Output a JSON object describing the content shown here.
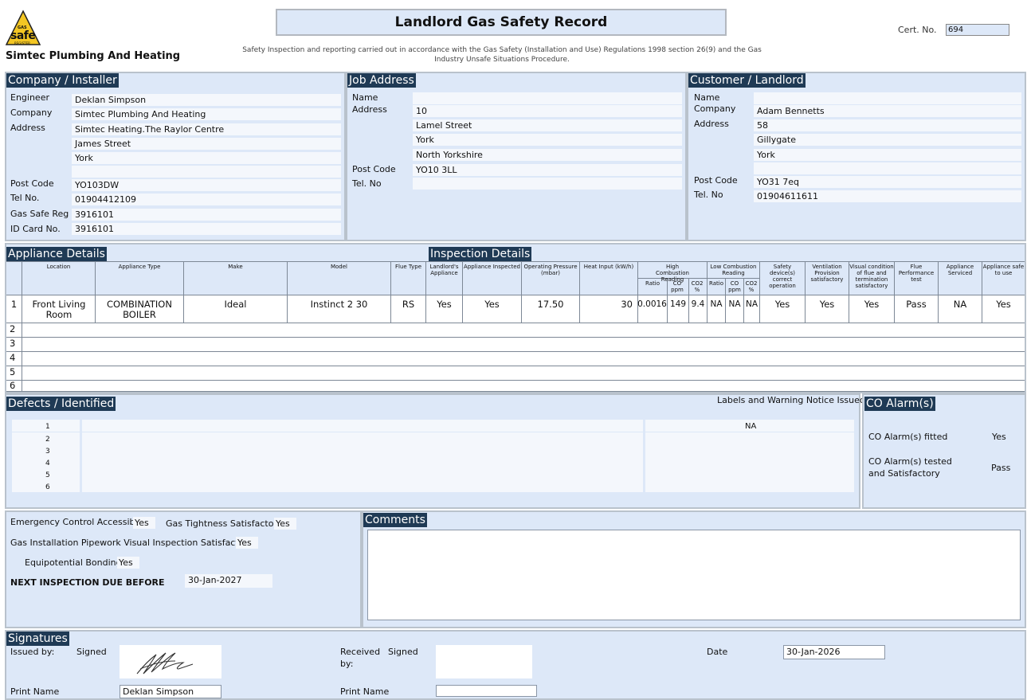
{
  "header": {
    "logo_text": "safe",
    "logo_small": "GAS",
    "logo_reg": "REGISTER",
    "company_name": "Simtec Plumbing And Heating",
    "title": "Landlord Gas Safety Record",
    "subtitle": "Safety Inspection and reporting carried out in accordance with the Gas Safety (Installation and Use) Regulations 1998 section 26(9) and the Gas Industry Unsafe Situations Procedure.",
    "cert_label": "Cert. No.",
    "cert_no": "694"
  },
  "installer": {
    "title": "Company / Installer",
    "labels": {
      "engineer": "Engineer",
      "company": "Company",
      "address": "Address",
      "post_code": "Post Code",
      "tel": "Tel No.",
      "gas_safe": "Gas Safe Reg",
      "id_card": "ID Card No."
    },
    "engineer": "Deklan Simpson",
    "company": "Simtec Plumbing And Heating",
    "address": [
      "Simtec Heating.The Raylor Centre",
      "James Street",
      "York",
      ""
    ],
    "post_code": "YO103DW",
    "tel": "01904412109",
    "gas_safe": "3916101",
    "id_card": "3916101"
  },
  "job": {
    "title": "Job Address",
    "labels": {
      "name": "Name",
      "address": "Address",
      "post_code": "Post Code",
      "tel": "Tel. No"
    },
    "name": "",
    "address": [
      "10",
      "Lamel Street",
      "York",
      "North Yorkshire"
    ],
    "post_code": "YO10 3LL",
    "tel": ""
  },
  "customer": {
    "title": "Customer / Landlord",
    "labels": {
      "name": "Name",
      "company": "Company",
      "address": "Address",
      "post_code": "Post Code",
      "tel": "Tel. No"
    },
    "name": "",
    "company": "Adam Bennetts",
    "address": [
      "58",
      "Gillygate",
      "York",
      ""
    ],
    "post_code": "YO31 7eq",
    "tel": "01904611611"
  },
  "appliances": {
    "title": "Appliance Details",
    "inspection_title": "Inspection Details",
    "headers": {
      "location": "Location",
      "type": "Appliance Type",
      "make": "Make",
      "model": "Model",
      "flue": "Flue Type",
      "landlords": "Landlord's Appliance",
      "inspected": "Appliance Inspected",
      "pressure": "Operating Pressure (mbar)",
      "heat": "Heat Input (kW/h)",
      "high": "High Combustion Reading",
      "low": "Low Combustion Reading",
      "ratio": "Ratio",
      "co": "CO ppm",
      "co2": "CO2 %",
      "safety": "Safety device(s) correct operation",
      "ventilation": "Ventilation Provision satisfactory",
      "visual": "Visual condition of flue and termination satisfactory",
      "flue_perf": "Flue Performance test",
      "serviced": "Appliance Serviced",
      "safe": "Appliance safe to use"
    },
    "row_numbers": [
      "1",
      "2",
      "3",
      "4",
      "5",
      "6"
    ],
    "row1": {
      "location": "Front Living Room",
      "type": "COMBINATION BOILER",
      "make": "Ideal",
      "model": "Instinct 2 30",
      "flue": "RS",
      "landlords": "Yes",
      "inspected": "Yes",
      "pressure": "17.50",
      "heat": "30",
      "h_ratio": "0.0016",
      "h_co": "149",
      "h_co2": "9.4",
      "l_ratio": "NA",
      "l_co": "NA",
      "l_co2": "NA",
      "safety": "Yes",
      "ventilation": "Yes",
      "visual": "Yes",
      "flue_perf": "Pass",
      "serviced": "NA",
      "safe": "Yes"
    }
  },
  "defects": {
    "title": "Defects / Identified",
    "labels_heading": "Labels and Warning Notice Issued",
    "numbers": [
      "1",
      "2",
      "3",
      "4",
      "5",
      "6"
    ],
    "labels_value_1": "NA"
  },
  "co_alarm": {
    "title": "CO Alarm(s)",
    "fitted_label": "CO Alarm(s) fitted",
    "fitted": "Yes",
    "tested_label_1": "CO Alarm(s) tested",
    "tested_label_2": "and Satisfactory",
    "tested": "Pass"
  },
  "checks": {
    "emergency_label": "Emergency Control Accessible",
    "emergency": "Yes",
    "tightness_label": "Gas Tightness Satisfactory",
    "tightness": "Yes",
    "pipework_label": "Gas Installation Pipework Visual Inspection Satisfactory",
    "pipework": "Yes",
    "bonding_label": "Equipotential Bonding",
    "bonding": "Yes",
    "next_label": "NEXT INSPECTION DUE BEFORE",
    "next_date": "30-Jan-2027"
  },
  "comments": {
    "title": "Comments",
    "text": ""
  },
  "signatures": {
    "title": "Signatures",
    "issued_label": "Issued by:",
    "signed_label": "Signed",
    "received_label_1": "Received",
    "received_label_2": "by:",
    "received_signed": "Signed",
    "date_label": "Date",
    "date": "30-Jan-2026",
    "print_label": "Print Name",
    "print_name": "Deklan Simpson",
    "received_print_label": "Print Name",
    "received_print_name": ""
  }
}
